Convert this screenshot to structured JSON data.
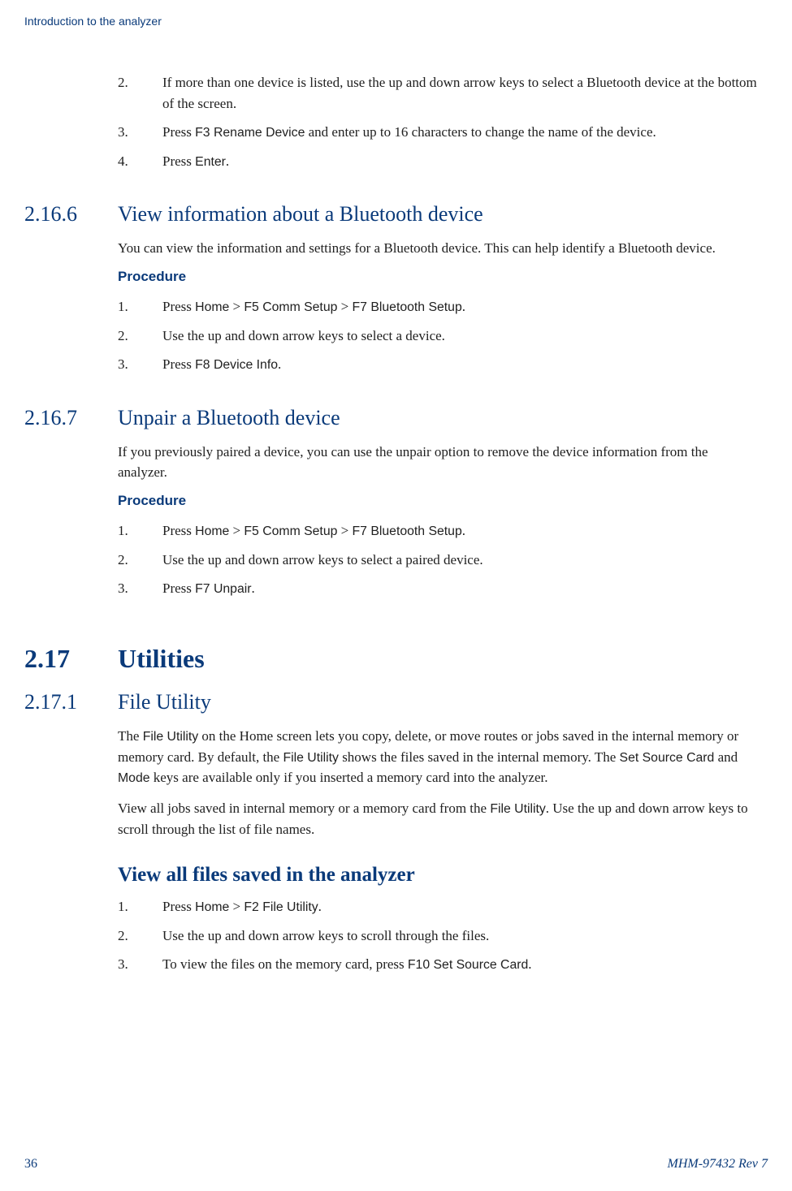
{
  "header": "Introduction to the analyzer",
  "topSteps": [
    {
      "num": "2.",
      "prefix": "",
      "body": "If more than one device is listed, use the up and down arrow keys to select a Bluetooth device at the bottom of the screen."
    },
    {
      "num": "3.",
      "prefix": "Press ",
      "ui": "F3 Rename Device",
      "suffix": " and enter up to 16 characters to change the name of the device."
    },
    {
      "num": "4.",
      "prefix": "Press ",
      "ui": "Enter",
      "suffix": "."
    }
  ],
  "sec2166": {
    "num": "2.16.6",
    "title": "View information about a Bluetooth device",
    "intro": "You can view the information and settings for a Bluetooth device. This can help identify a Bluetooth device.",
    "procLabel": "Procedure",
    "steps": [
      {
        "num": "1.",
        "parts": [
          {
            "t": "plain",
            "v": "Press "
          },
          {
            "t": "ui",
            "v": "Home"
          },
          {
            "t": "plain",
            "v": " > "
          },
          {
            "t": "ui",
            "v": "F5 Comm Setup"
          },
          {
            "t": "plain",
            "v": " > "
          },
          {
            "t": "ui",
            "v": "F7 Bluetooth Setup"
          },
          {
            "t": "plain",
            "v": "."
          }
        ]
      },
      {
        "num": "2.",
        "parts": [
          {
            "t": "plain",
            "v": "Use the up and down arrow keys to select a device."
          }
        ]
      },
      {
        "num": "3.",
        "parts": [
          {
            "t": "plain",
            "v": "Press "
          },
          {
            "t": "ui",
            "v": "F8 Device Info"
          },
          {
            "t": "plain",
            "v": "."
          }
        ]
      }
    ]
  },
  "sec2167": {
    "num": "2.16.7",
    "title": "Unpair a Bluetooth device",
    "intro": "If you previously paired a device, you can use the unpair option to remove the device information from the analyzer.",
    "procLabel": "Procedure",
    "steps": [
      {
        "num": "1.",
        "parts": [
          {
            "t": "plain",
            "v": "Press "
          },
          {
            "t": "ui",
            "v": "Home"
          },
          {
            "t": "plain",
            "v": " > "
          },
          {
            "t": "ui",
            "v": "F5 Comm Setup"
          },
          {
            "t": "plain",
            "v": " > "
          },
          {
            "t": "ui",
            "v": "F7 Bluetooth Setup"
          },
          {
            "t": "plain",
            "v": "."
          }
        ]
      },
      {
        "num": "2.",
        "parts": [
          {
            "t": "plain",
            "v": "Use the up and down arrow keys to select a paired device."
          }
        ]
      },
      {
        "num": "3.",
        "parts": [
          {
            "t": "plain",
            "v": "Press "
          },
          {
            "t": "ui",
            "v": "F7 Unpair"
          },
          {
            "t": "plain",
            "v": "."
          }
        ]
      }
    ]
  },
  "sec217": {
    "num": "2.17",
    "title": "Utilities"
  },
  "sec2171": {
    "num": "2.17.1",
    "title": "File Utility",
    "para1Parts": [
      {
        "t": "plain",
        "v": "The "
      },
      {
        "t": "ui",
        "v": "File Utility"
      },
      {
        "t": "plain",
        "v": " on the Home screen lets you copy, delete, or move routes or jobs saved in the internal memory or memory card. By default, the "
      },
      {
        "t": "ui",
        "v": "File Utility"
      },
      {
        "t": "plain",
        "v": " shows the files saved in the internal memory. The "
      },
      {
        "t": "ui",
        "v": "Set Source Card"
      },
      {
        "t": "plain",
        "v": " and "
      },
      {
        "t": "ui",
        "v": "Mode"
      },
      {
        "t": "plain",
        "v": " keys are available only if you inserted a memory card into the analyzer."
      }
    ],
    "para2Parts": [
      {
        "t": "plain",
        "v": "View all jobs saved in internal memory or a memory card from the "
      },
      {
        "t": "ui",
        "v": "File Utility"
      },
      {
        "t": "plain",
        "v": ". Use the up and down arrow keys to scroll through the list of file names."
      }
    ],
    "subHeading": "View all files saved in the analyzer",
    "steps": [
      {
        "num": "1.",
        "parts": [
          {
            "t": "plain",
            "v": "Press "
          },
          {
            "t": "ui",
            "v": "Home"
          },
          {
            "t": "plain",
            "v": " > "
          },
          {
            "t": "ui",
            "v": "F2 File Utility"
          },
          {
            "t": "plain",
            "v": "."
          }
        ]
      },
      {
        "num": "2.",
        "parts": [
          {
            "t": "plain",
            "v": "Use the up and down arrow keys to scroll through the files."
          }
        ]
      },
      {
        "num": "3.",
        "parts": [
          {
            "t": "plain",
            "v": "To view the files on the memory card, press "
          },
          {
            "t": "ui",
            "v": "F10 Set Source Card"
          },
          {
            "t": "plain",
            "v": "."
          }
        ]
      }
    ]
  },
  "footer": {
    "page": "36",
    "doc": "MHM-97432 Rev 7"
  }
}
